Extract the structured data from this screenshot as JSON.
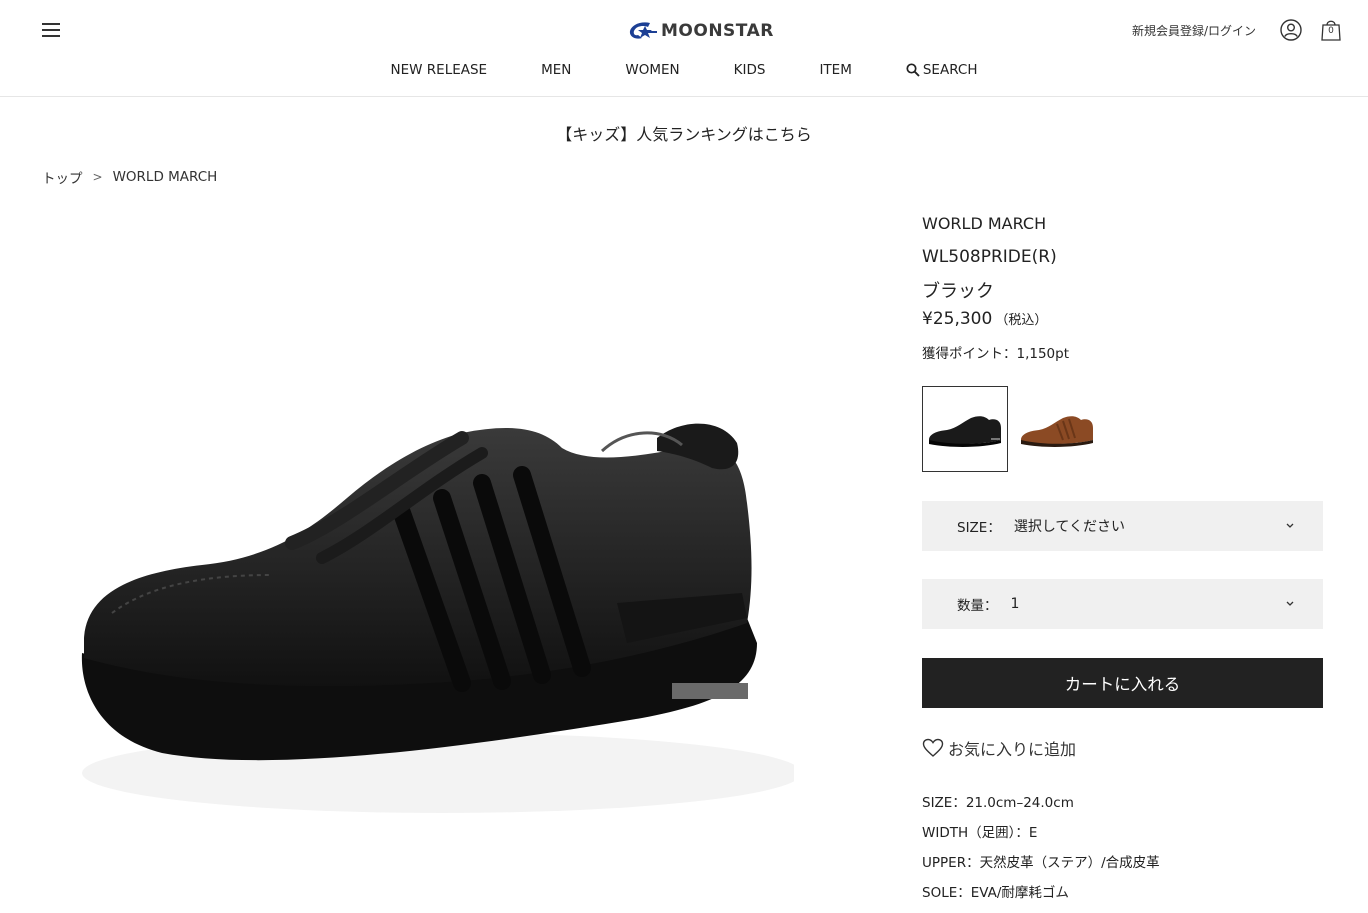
{
  "header": {
    "logo_text": "MOONSTAR",
    "login_label": "新規会員登録/ログイン",
    "cart_count": "0",
    "brand_color": "#1c3f94"
  },
  "nav": {
    "items": [
      "NEW RELEASE",
      "MEN",
      "WOMEN",
      "KIDS",
      "ITEM"
    ],
    "search_label": "SEARCH"
  },
  "banner": {
    "text": "【キッズ】人気ランキングはこちら"
  },
  "breadcrumb": {
    "home": "トップ",
    "separator": ">",
    "current": "WORLD MARCH"
  },
  "product": {
    "brand": "WORLD MARCH",
    "model": "WL508PRIDE(R)",
    "color": "ブラック",
    "price": "¥25,300",
    "tax_note": "（税込）",
    "points": "獲得ポイント：1,150pt",
    "swatches": [
      {
        "color_name": "black",
        "hex": "#1a1a1a",
        "selected": true
      },
      {
        "color_name": "brown",
        "hex": "#8b4a24",
        "selected": false
      }
    ],
    "size_label": "SIZE：",
    "size_value": "選択してください",
    "qty_label": "数量：",
    "qty_value": "1",
    "cart_button": "カートに入れる",
    "favorite_label": "お気に入りに追加",
    "specs": [
      "SIZE：21.0cm–24.0cm",
      "WIDTH（足囲）：E",
      "UPPER：天然皮革（ステア）/合成皮革",
      "SOLE：EVA/耐摩耗ゴム"
    ]
  }
}
